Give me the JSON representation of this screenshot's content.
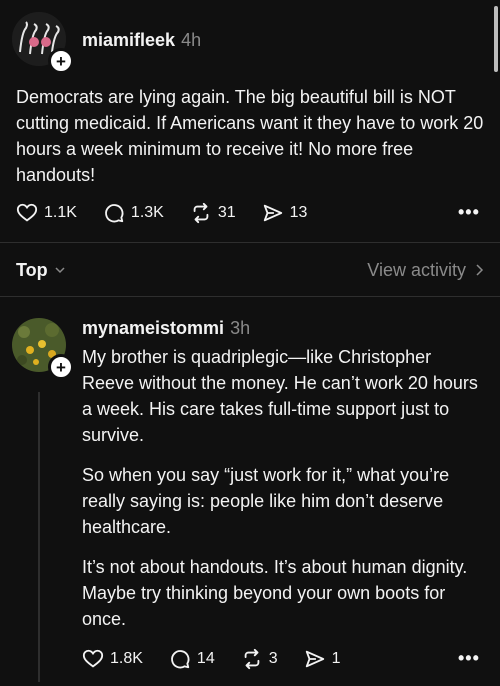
{
  "post": {
    "username": "miamifleek",
    "time": "4h",
    "text": "Democrats are lying again. The big beautiful bill is NOT cutting medicaid. If Americans want it they have to work 20 hours a week minimum to receive it! No more free handouts!",
    "likes": "1.1K",
    "replies": "1.3K",
    "reposts": "31",
    "shares": "13"
  },
  "sort": {
    "label": "Top",
    "activity": "View activity"
  },
  "reply": {
    "username": "mynameistommi",
    "time": "3h",
    "paragraphs": [
      "My brother is quadriplegic—like Christopher Reeve without the money. He can’t work 20 hours a week. His care takes full-time support just to survive.",
      "So when you say “just work for it,” what you’re really saying is: people like him don’t deserve healthcare.",
      "It’s not about handouts. It’s about human dignity. Maybe try thinking beyond your own boots for once."
    ],
    "likes": "1.8K",
    "replies": "14",
    "reposts": "3",
    "shares": "1"
  },
  "icons": {
    "like": "heart-icon",
    "reply": "comment-icon",
    "repost": "repost-icon",
    "share": "share-icon",
    "more": "more-icon",
    "follow": "plus-icon"
  },
  "colors": {
    "background": "#101010",
    "text": "#f3f3f3",
    "muted": "#8a8a8a"
  }
}
